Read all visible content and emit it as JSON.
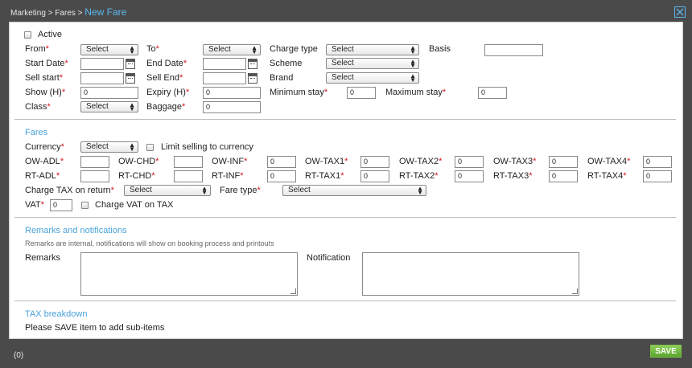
{
  "breadcrumb": {
    "part1": "Marketing",
    "sep1": ">",
    "part2": "Fares",
    "sep2": ">",
    "current": "New Fare"
  },
  "icons": {
    "close": "close-icon",
    "calendar": "calendar-icon",
    "select_arrow": "updown-arrow-icon",
    "resize": "resize-grip-icon"
  },
  "colors": {
    "accent": "#4aa2d9",
    "required": "#d0161b",
    "save": "#5aa52d",
    "background": "#4a4a4a"
  },
  "form": {
    "active_label": "Active",
    "from_label": "From",
    "to_label": "To",
    "charge_type_label": "Charge type",
    "basis_label": "Basis",
    "start_date_label": "Start Date",
    "end_date_label": "End Date",
    "scheme_label": "Scheme",
    "sell_start_label": "Sell start",
    "sell_end_label": "Sell End",
    "brand_label": "Brand",
    "show_label": "Show (H)",
    "expiry_label": "Expiry (H)",
    "min_stay_label": "Minimum stay",
    "max_stay_label": "Maximum stay",
    "class_label": "Class",
    "baggage_label": "Baggage",
    "select_text": "Select",
    "show_value": "0",
    "expiry_value": "0",
    "min_stay_value": "0",
    "max_stay_value": "0",
    "baggage_value": "0"
  },
  "fares": {
    "title": "Fares",
    "currency_label": "Currency",
    "limit_label": "Limit selling to currency",
    "ow_adl": "OW-ADL",
    "ow_chd": "OW-CHD",
    "ow_inf": "OW-INF",
    "ow_tax1": "OW-TAX1",
    "ow_tax2": "OW-TAX2",
    "ow_tax3": "OW-TAX3",
    "ow_tax4": "OW-TAX4",
    "rt_adl": "RT-ADL",
    "rt_chd": "RT-CHD",
    "rt_inf": "RT-INF",
    "rt_tax1": "RT-TAX1",
    "rt_tax2": "RT-TAX2",
    "rt_tax3": "RT-TAX3",
    "rt_tax4": "RT-TAX4",
    "zero": "0",
    "charge_tax_label": "Charge TAX on return",
    "fare_type_label": "Fare type",
    "vat_label": "VAT",
    "vat_value": "0",
    "charge_vat_label": "Charge VAT on TAX"
  },
  "remarks": {
    "title": "Remarks and notifications",
    "note": "Remarks are internal, notifications will show on booking process and printouts",
    "remarks_label": "Remarks",
    "notification_label": "Notification"
  },
  "tax": {
    "title": "TAX breakdown",
    "message": "Please SAVE item to add sub-items"
  },
  "footer": {
    "count": "(0)",
    "save_label": "SAVE"
  }
}
